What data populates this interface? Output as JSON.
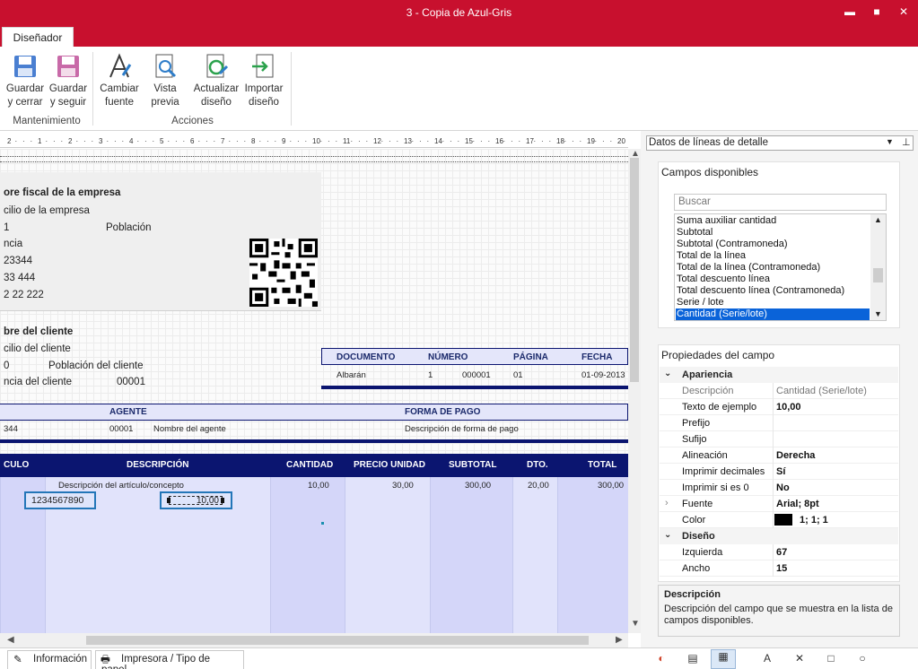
{
  "window": {
    "title": "3 - Copia de Azul-Gris",
    "minimize": "▬",
    "maximize": "■",
    "close": "✕"
  },
  "ribbon": {
    "tab": "Diseñador",
    "buttons": {
      "guardar_cerrar": "Guardar\ny cerrar",
      "guardar_seguir": "Guardar\ny seguir",
      "cambiar_fuente": "Cambiar\nfuente",
      "vista_previa": "Vista\nprevia",
      "actualizar": "Actualizar\ndiseño",
      "importar": "Importar\ndiseño"
    },
    "groups": {
      "mantenimiento": "Mantenimiento",
      "acciones": "Acciones"
    }
  },
  "ruler": [
    "2",
    "1",
    "2",
    "3",
    "4",
    "5",
    "6",
    "7",
    "8",
    "9",
    "10",
    "11",
    "12",
    "13",
    "14",
    "15",
    "16",
    "17",
    "18",
    "19",
    "20"
  ],
  "canvas": {
    "company": {
      "name": "ore fiscal de la empresa",
      "address": "cilio de la empresa",
      "zip": "1",
      "city": "Población",
      "province": "ncia",
      "phone1": "23344",
      "phone2": "33 444",
      "phone3": "2 22 222"
    },
    "client": {
      "name": "bre del cliente",
      "address": "cilio del cliente",
      "zip": "0",
      "city": "Población del cliente",
      "province": "ncia del cliente",
      "code": "00001"
    },
    "docbox": {
      "headers": [
        "DOCUMENTO",
        "NÚMERO",
        "PÁGINA",
        "FECHA"
      ],
      "doc": "Albarán",
      "serie": "1",
      "numero": "000001",
      "pagina": "01",
      "fecha": "01-09-2013"
    },
    "agent": {
      "h_agente": "AGENTE",
      "h_forma": "FORMA DE PAGO",
      "code_prefix": "344",
      "agent_code": "00001",
      "agent_name": "Nombre del agente",
      "forma": "Descripción de forma de pago"
    },
    "table": {
      "headers": [
        "CULO",
        "DESCRIPCIÓN",
        "CANTIDAD",
        "PRECIO UNIDAD",
        "SUBTOTAL",
        "DTO.",
        "TOTAL"
      ],
      "descripcion": "Descripción del artículo/concepto",
      "codigo": "1234567890",
      "serie_cantidad": "10,00",
      "cantidad": "10,00",
      "precio": "30,00",
      "subtotal": "300,00",
      "dto": "20,00",
      "total": "300,00"
    }
  },
  "panel": {
    "dropdown": "Datos de líneas de detalle",
    "campos_title": "Campos disponibles",
    "search_placeholder": "Buscar",
    "fields": [
      "Suma auxiliar cantidad",
      "Subtotal",
      "Subtotal  (Contramoneda)",
      "Total de la línea",
      "Total de la línea  (Contramoneda)",
      "Total descuento línea",
      "Total descuento línea (Contramoneda)",
      "Serie / lote",
      "Cantidad (Serie/lote)"
    ],
    "selected_field": "Cantidad (Serie/lote)",
    "props_title": "Propiedades del campo",
    "props": {
      "apariencia": "Apariencia",
      "descripcion_k": "Descripción",
      "descripcion_v": "Cantidad (Serie/lote)",
      "texto_k": "Texto de ejemplo",
      "texto_v": "10,00",
      "prefijo_k": "Prefijo",
      "sufijo_k": "Sufijo",
      "alineacion_k": "Alineación",
      "alineacion_v": "Derecha",
      "decimales_k": "Imprimir decimales",
      "decimales_v": "Sí",
      "si_cero_k": "Imprimir si es 0",
      "si_cero_v": "No",
      "fuente_k": "Fuente",
      "fuente_v": "Arial; 8pt",
      "color_k": "Color",
      "color_v": "1; 1; 1",
      "color_swatch": "#000000",
      "diseno": "Diseño",
      "izquierda_k": "Izquierda",
      "izquierda_v": "67",
      "ancho_k": "Ancho",
      "ancho_v": "15"
    },
    "desc_title": "Descripción",
    "desc_text": "Descripción del campo que se muestra en la lista de campos disponibles."
  },
  "bottom_tabs": {
    "informacion": "Información",
    "impresora": "Impresora / Tipo de papel"
  },
  "colors": {
    "titlebar": "#c8102e",
    "navy": "#0b1570",
    "selection": "#0a63d9"
  }
}
